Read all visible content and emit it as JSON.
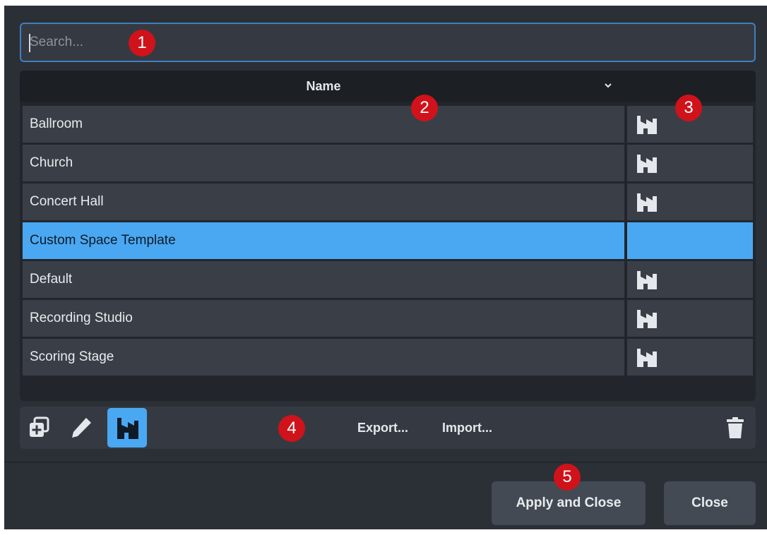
{
  "search": {
    "placeholder": "Search..."
  },
  "table": {
    "header": {
      "name_label": "Name"
    },
    "rows": [
      {
        "name": "Ballroom",
        "factory": true
      },
      {
        "name": "Church",
        "factory": true
      },
      {
        "name": "Concert Hall",
        "factory": true
      },
      {
        "name": "Custom Space Template",
        "factory": false,
        "selected": true
      },
      {
        "name": "Default",
        "factory": true
      },
      {
        "name": "Recording Studio",
        "factory": true
      },
      {
        "name": "Scoring Stage",
        "factory": true
      }
    ]
  },
  "toolbar": {
    "export_label": "Export...",
    "import_label": "Import...",
    "icons": [
      "duplicate-icon",
      "pencil-icon",
      "factory-icon",
      "trash-icon"
    ]
  },
  "footer": {
    "apply_label": "Apply and Close",
    "close_label": "Close"
  },
  "callouts": [
    "1",
    "2",
    "3",
    "4",
    "5"
  ],
  "colors": {
    "selection": "#4aa8f2",
    "callout": "#d0121b",
    "background": "#2b2f36"
  }
}
